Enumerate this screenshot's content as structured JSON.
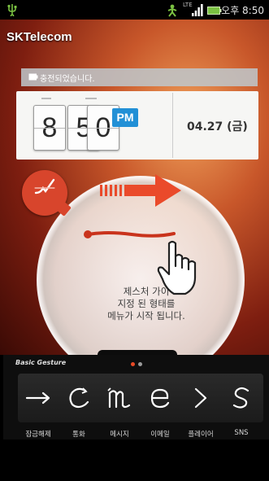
{
  "status_bar": {
    "time": "오후 8:50",
    "network": "LTE",
    "icons": [
      "usb-icon",
      "signal-person-icon",
      "signal-bars-icon",
      "battery-icon"
    ]
  },
  "carrier": "SKTelecom",
  "notification": {
    "text": "충전되었습니다.",
    "icon": "battery-full-icon"
  },
  "clock": {
    "hour": "8",
    "minute_tens": "5",
    "minute_ones": "0",
    "ampm": "PM",
    "date": "04.27 (금)",
    "accent": "#2290d6"
  },
  "gesture_guide": {
    "text_line1": "제스처 가이",
    "text_line2": "지정 된 형태를",
    "text_line3": "메뉴가 시작 됩니다.",
    "icons": [
      "gesture-badge-icon",
      "arrow-right-icon",
      "hand-pointer-icon"
    ],
    "accent": "#e94a26"
  },
  "gesture_panel": {
    "title": "Basic Gesture",
    "page_indicator": {
      "active": 1,
      "total": 2
    },
    "items": [
      {
        "label": "잠금해제",
        "icon": "arrow-right-stroke-icon"
      },
      {
        "label": "통화",
        "icon": "c-stroke-icon"
      },
      {
        "label": "메시지",
        "icon": "m-stroke-icon"
      },
      {
        "label": "이메일",
        "icon": "e-stroke-icon"
      },
      {
        "label": "플레이어",
        "icon": "chevron-right-stroke-icon"
      },
      {
        "label": "SNS",
        "icon": "s-stroke-icon"
      }
    ]
  }
}
